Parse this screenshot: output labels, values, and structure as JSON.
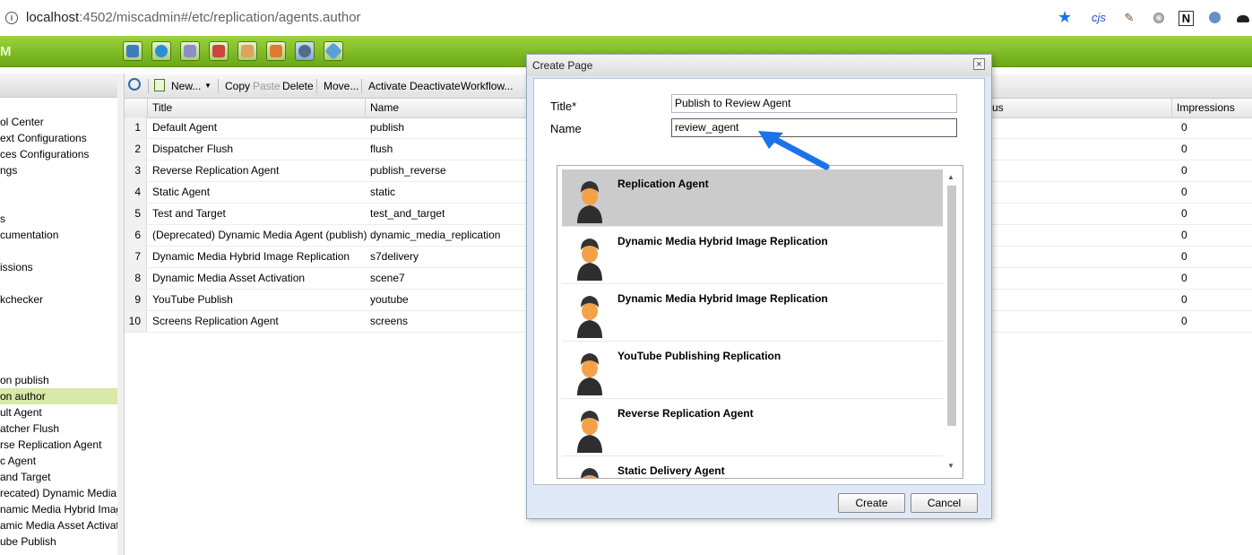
{
  "browser": {
    "url_host": "localhost",
    "url_rest": ":4502/miscadmin#/etc/replication/agents.author",
    "extensions": [
      "star-icon",
      "cjs-icon",
      "pen-icon",
      "circle-icon",
      "n-icon",
      "shield-icon",
      "spy-icon"
    ],
    "ext_cjs": "cjs",
    "ext_n": "N"
  },
  "header": {
    "logo": "M"
  },
  "toolbar": {
    "new_label": "New...",
    "copy_label": "Copy",
    "paste_label": "Paste",
    "delete_label": "Delete",
    "move_label": "Move...",
    "activate_label": "Activate",
    "deactivate_label": "Deactivate",
    "workflow_label": "Workflow..."
  },
  "tree": {
    "items": [
      "ol Center",
      "ext Configurations",
      "ces Configurations",
      "ngs",
      "s",
      "cumentation",
      "issions",
      "kchecker",
      "on publish",
      "on author",
      "ult Agent",
      "atcher Flush",
      "rse Replication Agent",
      "c Agent",
      "and Target",
      "recated) Dynamic Media Ag",
      "namic Media Hybrid Image R",
      "amic Media Asset Activation",
      "ube Publish"
    ]
  },
  "grid": {
    "columns": {
      "title": "Title",
      "name": "Name",
      "status": "atus",
      "impressions": "Impressions"
    },
    "rows": [
      {
        "num": "1",
        "title": "Default Agent",
        "name": "publish",
        "impressions": "0"
      },
      {
        "num": "2",
        "title": "Dispatcher Flush",
        "name": "flush",
        "impressions": "0"
      },
      {
        "num": "3",
        "title": "Reverse Replication Agent",
        "name": "publish_reverse",
        "impressions": "0"
      },
      {
        "num": "4",
        "title": "Static Agent",
        "name": "static",
        "impressions": "0"
      },
      {
        "num": "5",
        "title": "Test and Target",
        "name": "test_and_target",
        "impressions": "0"
      },
      {
        "num": "6",
        "title": "(Deprecated) Dynamic Media Agent (publish)",
        "name": "dynamic_media_replication",
        "impressions": "0"
      },
      {
        "num": "7",
        "title": "Dynamic Media Hybrid Image Replication",
        "name": "s7delivery",
        "impressions": "0"
      },
      {
        "num": "8",
        "title": "Dynamic Media Asset Activation",
        "name": "scene7",
        "impressions": "0"
      },
      {
        "num": "9",
        "title": "YouTube Publish",
        "name": "youtube",
        "impressions": "0"
      },
      {
        "num": "10",
        "title": "Screens Replication Agent",
        "name": "screens",
        "impressions": "0"
      }
    ]
  },
  "dialog": {
    "title": "Create Page",
    "close": "×",
    "title_label": "Title*",
    "title_value": "Publish to Review Agent",
    "name_label": "Name",
    "name_value": "review_agent",
    "templates": [
      "Replication Agent",
      "Dynamic Media Hybrid Image Replication",
      "Dynamic Media Hybrid Image Replication",
      "YouTube Publishing Replication",
      "Reverse Replication Agent",
      "Static Delivery Agent"
    ],
    "selected_template": "Replication Agent",
    "create_label": "Create",
    "cancel_label": "Cancel"
  },
  "colors": {
    "header_green": "#7dbd21",
    "selected_row": "#d8e9a8",
    "arrow_blue": "#1a73e8"
  }
}
